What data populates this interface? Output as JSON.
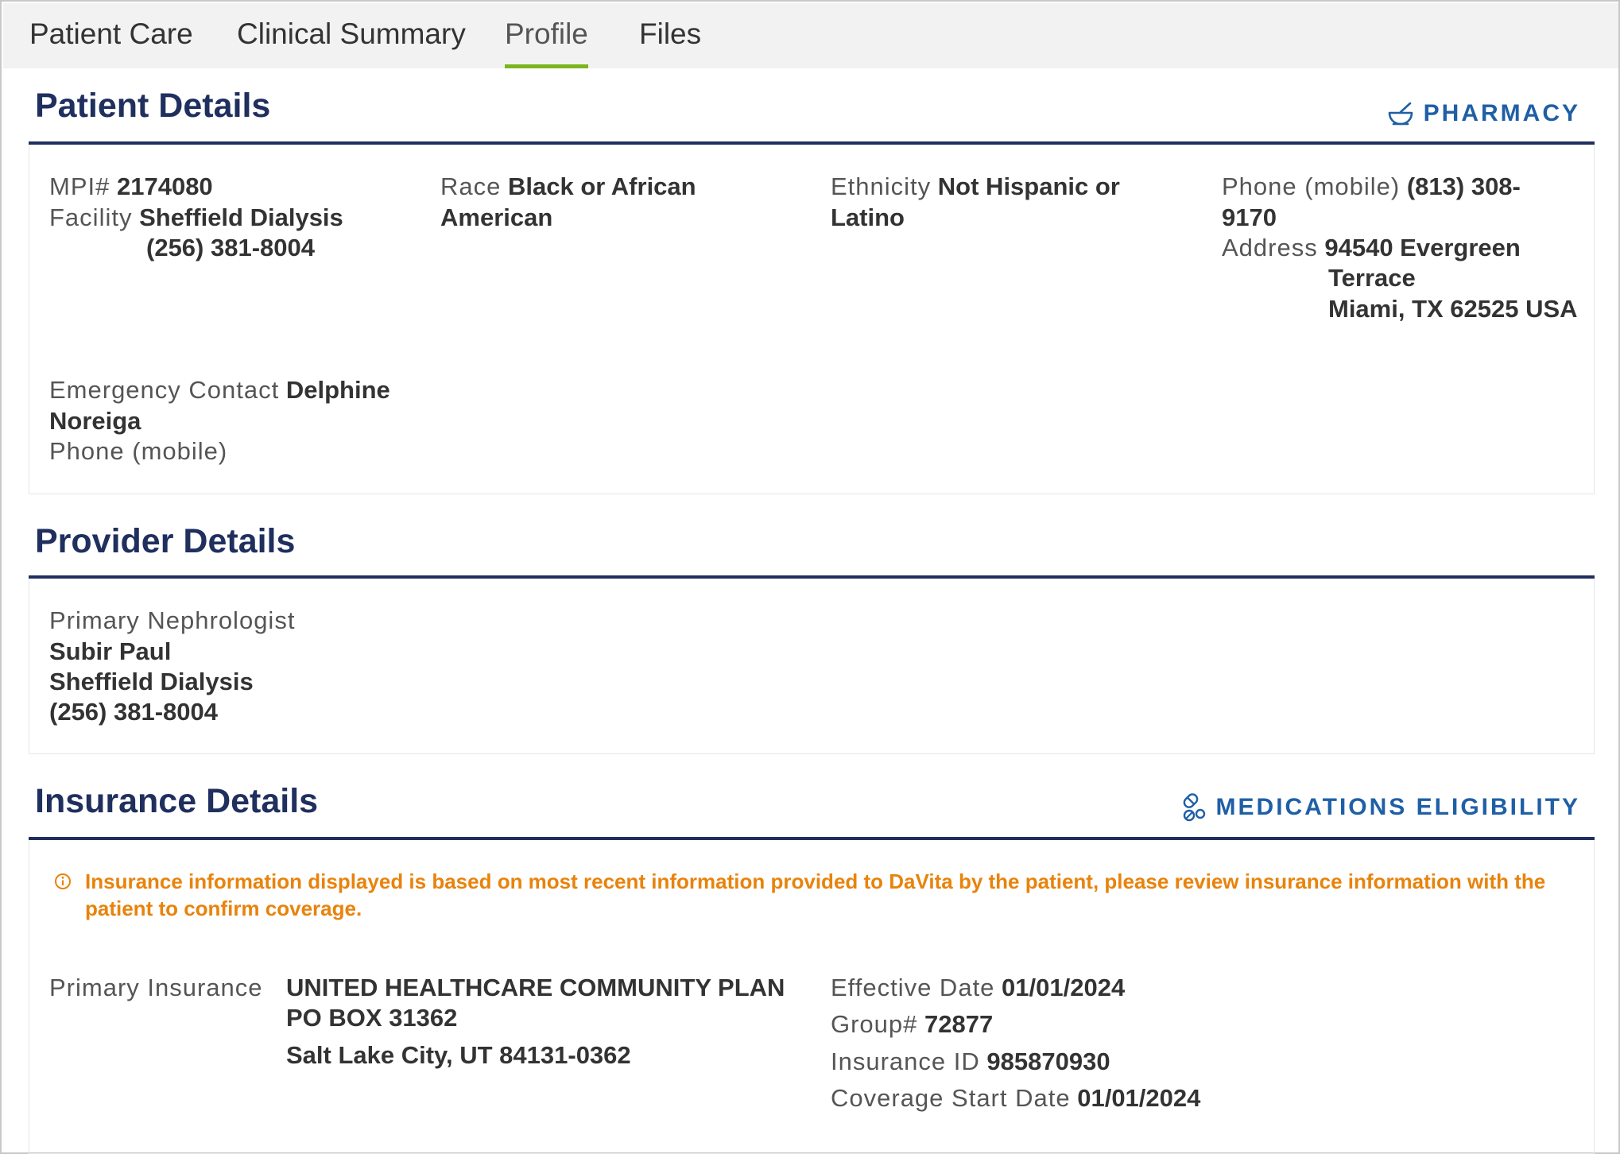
{
  "tabs": [
    {
      "label": "Patient Care"
    },
    {
      "label": "Clinical Summary"
    },
    {
      "label": "Profile"
    },
    {
      "label": "Files"
    }
  ],
  "patient": {
    "title": "Patient Details",
    "pharmacy_label": "PHARMACY",
    "mpi_label": "MPI#",
    "mpi_value": "2174080",
    "facility_label": "Facility",
    "facility_name": "Sheffield Dialysis",
    "facility_phone": "(256) 381-8004",
    "race_label": "Race",
    "race_value_1": "Black or African",
    "race_value_2": "American",
    "ethnicity_label": "Ethnicity",
    "ethnicity_value_1": "Not Hispanic or",
    "ethnicity_value_2": "Latino",
    "phone_label": "Phone (mobile)",
    "phone_value_1": "(813) 308-",
    "phone_value_2": "9170",
    "address_label": "Address",
    "address_line_1": "94540 Evergreen",
    "address_line_2": "Terrace",
    "address_line_3": "Miami, TX 62525 USA",
    "emergency_label": "Emergency Contact",
    "emergency_value_1": "Delphine",
    "emergency_value_2": "Noreiga",
    "emergency_phone_label": "Phone (mobile)"
  },
  "provider": {
    "title": "Provider Details",
    "nephrologist_label": "Primary Nephrologist",
    "name": "Subir Paul",
    "facility": "Sheffield Dialysis",
    "phone": "(256) 381-8004"
  },
  "insurance": {
    "title": "Insurance Details",
    "eligibility_label": "MEDICATIONS ELIGIBILITY",
    "alert_text": "Insurance information displayed is based on most recent information provided to DaVita by the patient, please review insurance information with the patient to confirm coverage.",
    "alert_color": "#e8830c",
    "primary_label": "Primary Insurance",
    "plan_name": "UNITED HEALTHCARE COMMUNITY PLAN",
    "plan_address_1": "PO BOX 31362",
    "plan_address_2": "Salt Lake City, UT 84131-0362",
    "effective_label": "Effective Date",
    "effective_value": "01/01/2024",
    "group_label": "Group#",
    "group_value": "72877",
    "insurance_id_label": "Insurance ID",
    "insurance_id_value": "985870930",
    "coverage_label": "Coverage Start Date",
    "coverage_value": "01/01/2024"
  },
  "colors": {
    "heading": "#1f2f5e",
    "link": "#1f5fa6",
    "active_tab_underline": "#7ab51d"
  }
}
